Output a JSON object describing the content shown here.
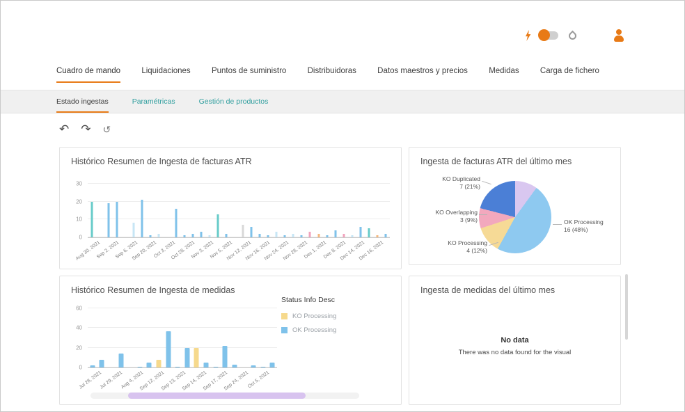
{
  "palette": {
    "blue": "#7fc2ea",
    "teal": "#67cbc9",
    "lightblue": "#c7e6f5",
    "pink": "#f1a3bd",
    "orange": "#f5b97f",
    "gray": "#d8d8d8",
    "yellow": "#f6d98c"
  },
  "accent": "#e87a16",
  "nav": {
    "tabs": [
      {
        "label": "Cuadro de mando",
        "active": true
      },
      {
        "label": "Liquidaciones"
      },
      {
        "label": "Puntos de suministro"
      },
      {
        "label": "Distribuidoras"
      },
      {
        "label": "Datos maestros y precios"
      },
      {
        "label": "Medidas"
      },
      {
        "label": "Carga de fichero"
      }
    ]
  },
  "subnav": {
    "items": [
      {
        "label": "Estado ingestas",
        "active": true
      },
      {
        "label": "Paramétricas"
      },
      {
        "label": "Gestión de productos"
      }
    ]
  },
  "toolbar": {
    "buttons": [
      {
        "name": "undo",
        "glyph": "↶"
      },
      {
        "name": "redo",
        "glyph": "↷"
      },
      {
        "name": "reset",
        "glyph": "↺"
      }
    ]
  },
  "cards": {
    "medidas_nodata": {
      "title": "Ingesta de medidas del último mes",
      "nodata_title": "No data",
      "nodata_text": "There was no data found for the visual"
    }
  },
  "chart_data": [
    {
      "type": "bar",
      "title": "Histórico Resumen de Ingesta de facturas ATR",
      "ylim": [
        0,
        30
      ],
      "yticks": [
        0,
        10,
        20,
        30
      ],
      "x_labels": [
        "Aug 30, 2021",
        "Sep 2, 2021",
        "Sep 6, 2021",
        "Sep 20, 2021",
        "Oct 3, 2021",
        "Oct 28, 2021",
        "Nov 3, 2021",
        "Nov 5, 2021",
        "Nov 12, 2021",
        "Nov 16, 2021",
        "Nov 24, 2021",
        "Nov 28, 2021",
        "Dec 1, 2021",
        "Dec 8, 2021",
        "Dec 14, 2021",
        "Dec 16, 2021"
      ],
      "bars": [
        {
          "v": 20,
          "c": "teal"
        },
        {
          "v": 0,
          "c": "blue"
        },
        {
          "v": 19,
          "c": "blue"
        },
        {
          "v": 20,
          "c": "blue"
        },
        {
          "v": 0,
          "c": "blue"
        },
        {
          "v": 8,
          "c": "lightblue"
        },
        {
          "v": 21,
          "c": "blue"
        },
        {
          "v": 1,
          "c": "blue"
        },
        {
          "v": 2,
          "c": "lightblue"
        },
        {
          "v": 0,
          "c": "blue"
        },
        {
          "v": 16,
          "c": "blue"
        },
        {
          "v": 1,
          "c": "blue"
        },
        {
          "v": 2,
          "c": "blue"
        },
        {
          "v": 3,
          "c": "blue"
        },
        {
          "v": 1,
          "c": "lightblue"
        },
        {
          "v": 13,
          "c": "teal"
        },
        {
          "v": 2,
          "c": "blue"
        },
        {
          "v": 0,
          "c": "blue"
        },
        {
          "v": 7,
          "c": "gray"
        },
        {
          "v": 6,
          "c": "blue"
        },
        {
          "v": 2,
          "c": "blue"
        },
        {
          "v": 1,
          "c": "blue"
        },
        {
          "v": 3,
          "c": "lightblue"
        },
        {
          "v": 1,
          "c": "blue"
        },
        {
          "v": 2,
          "c": "lightblue"
        },
        {
          "v": 1,
          "c": "blue"
        },
        {
          "v": 3,
          "c": "pink"
        },
        {
          "v": 2,
          "c": "orange"
        },
        {
          "v": 1,
          "c": "blue"
        },
        {
          "v": 4,
          "c": "blue"
        },
        {
          "v": 2,
          "c": "pink"
        },
        {
          "v": 1,
          "c": "lightblue"
        },
        {
          "v": 6,
          "c": "blue"
        },
        {
          "v": 5,
          "c": "teal"
        },
        {
          "v": 1,
          "c": "orange"
        },
        {
          "v": 2,
          "c": "blue"
        }
      ]
    },
    {
      "type": "pie",
      "title": "Ingesta de facturas ATR del último mes",
      "slices": [
        {
          "label": "",
          "value": 10,
          "color": "#d9c7f0"
        },
        {
          "label": "OK Processing",
          "value": 48,
          "color": "#8ec9f0"
        },
        {
          "label": "KO Processing",
          "value": 12,
          "color": "#f6da96"
        },
        {
          "label": "KO Overlapping",
          "value": 9,
          "color": "#f2a8bd"
        },
        {
          "label": "KO Duplicated",
          "value": 21,
          "color": "#4b7fd6"
        }
      ],
      "callouts": [
        {
          "name": "KO Duplicated",
          "value": "7 (21%)"
        },
        {
          "name": "KO Overlapping",
          "value": "3 (9%)"
        },
        {
          "name": "KO Processing",
          "value": "4 (12%)"
        },
        {
          "name": "OK Processing",
          "value": "16 (48%)"
        }
      ]
    },
    {
      "type": "bar",
      "title": "Histórico Resumen de Ingesta de medidas",
      "legend_title": "Status Info Desc",
      "legend": [
        {
          "label": "KO Processing",
          "color": "yellow"
        },
        {
          "label": "OK Processing",
          "color": "blue"
        }
      ],
      "ylim": [
        0,
        60
      ],
      "yticks": [
        0,
        20,
        40,
        60
      ],
      "x_labels": [
        "Jul 28, 2021",
        "Jul 29, 2021",
        "Aug 4, 2021",
        "Sep 12, 2021",
        "Sep 13, 2021",
        "Sep 14, 2021",
        "Sep 17, 2021",
        "Sep 24, 2021",
        "Oct 5, 2021"
      ],
      "bars": [
        {
          "v": 2,
          "c": "blue"
        },
        {
          "v": 8,
          "c": "blue"
        },
        {
          "v": 0,
          "c": "blue"
        },
        {
          "v": 14,
          "c": "blue"
        },
        {
          "v": 0,
          "c": "blue"
        },
        {
          "v": 1,
          "c": "blue"
        },
        {
          "v": 5,
          "c": "blue"
        },
        {
          "v": 8,
          "c": "yellow"
        },
        {
          "v": 37,
          "c": "blue"
        },
        {
          "v": 1,
          "c": "blue"
        },
        {
          "v": 20,
          "c": "blue"
        },
        {
          "v": 20,
          "c": "yellow"
        },
        {
          "v": 5,
          "c": "blue"
        },
        {
          "v": 1,
          "c": "blue"
        },
        {
          "v": 22,
          "c": "blue"
        },
        {
          "v": 3,
          "c": "blue"
        },
        {
          "v": 0,
          "c": "blue"
        },
        {
          "v": 2,
          "c": "blue"
        },
        {
          "v": 1,
          "c": "blue"
        },
        {
          "v": 5,
          "c": "blue"
        }
      ]
    }
  ]
}
